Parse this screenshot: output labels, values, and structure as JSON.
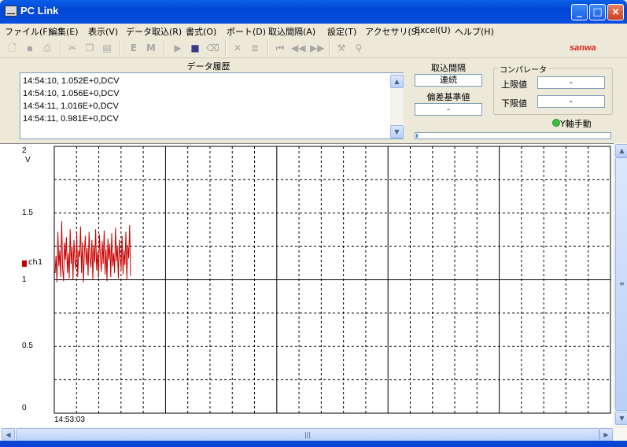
{
  "window": {
    "title": "PC Link"
  },
  "menu": [
    "ファイル(F)",
    "編集(E)",
    "表示(V)",
    "データ取込(R)",
    "書式(O)",
    "ポート(D)",
    "取込間隔(A)",
    "設定(T)",
    "アクセサリ(S)",
    "Excel(U)",
    "ヘルプ(H)"
  ],
  "toolbar": {
    "icons": [
      "new-icon",
      "save-icon",
      "print-icon",
      "cut-icon",
      "copy-icon",
      "paste-icon",
      "e-icon",
      "m-icon",
      "play-icon",
      "stop-icon",
      "clear-icon",
      "delete-icon",
      "list-icon",
      "first-icon",
      "prev-icon",
      "next-icon",
      "tools-icon",
      "pin-icon"
    ],
    "e_label": "E",
    "m_label": "M",
    "logo": "sanwa"
  },
  "history": {
    "label": "データ履歴",
    "lines": [
      "14:54:10, 1.052E+0,DCV",
      "14:54:10, 1.056E+0,DCV",
      "14:54:11, 1.016E+0,DCV",
      "14:54:11, 0.981E+0,DCV"
    ]
  },
  "interval": {
    "label": "取込間隔",
    "value": "連続"
  },
  "deviation": {
    "label": "偏差基準値",
    "value": "-"
  },
  "comparator": {
    "legend": "コンパレータ",
    "upper_label": "上限値",
    "upper_value": "-",
    "lower_label": "下限値",
    "lower_value": "-"
  },
  "y_axis_mode": {
    "label": "Y軸手動",
    "color": "#3ec23e"
  },
  "progress_fraction": 0.01,
  "chart_data": {
    "type": "line",
    "ylim": [
      0,
      2
    ],
    "unit_label": "V",
    "ytick_labels": [
      "2",
      "1.5",
      "1",
      "0.5",
      "0"
    ],
    "yticks": [
      2,
      1.5,
      1,
      0.5,
      0
    ],
    "x_start_label": "14:53:03",
    "x_divisions": 5,
    "series": [
      {
        "name": "ch1",
        "color": "#cc0000",
        "values": [
          1.05,
          1.18,
          0.98,
          1.36,
          1.1,
          1.22,
          1.02,
          1.44,
          1.08,
          0.99,
          1.28,
          1.15,
          1.32,
          1.05,
          1.2,
          1.01,
          1.38,
          1.12,
          1.25,
          1.0,
          1.3,
          1.14,
          1.08,
          1.35,
          1.02,
          1.22,
          1.17,
          1.4,
          1.05,
          1.28,
          0.98,
          1.19,
          1.33,
          1.11,
          1.24,
          1.03,
          1.36,
          1.16,
          1.09,
          1.3,
          1.0,
          1.26,
          1.13,
          1.38,
          1.07,
          1.21,
          1.01,
          1.34,
          1.18,
          1.06,
          1.29,
          1.12,
          1.37,
          1.04,
          1.23,
          0.99,
          1.31,
          1.15,
          1.27,
          1.02,
          1.35,
          1.1,
          1.2,
          1.05,
          1.39,
          1.14,
          1.25,
          1.01,
          1.3,
          1.17,
          1.08,
          1.33,
          1.04,
          1.22,
          1.11,
          1.36,
          1.0,
          1.26,
          1.16,
          1.41,
          1.03
        ]
      }
    ]
  }
}
